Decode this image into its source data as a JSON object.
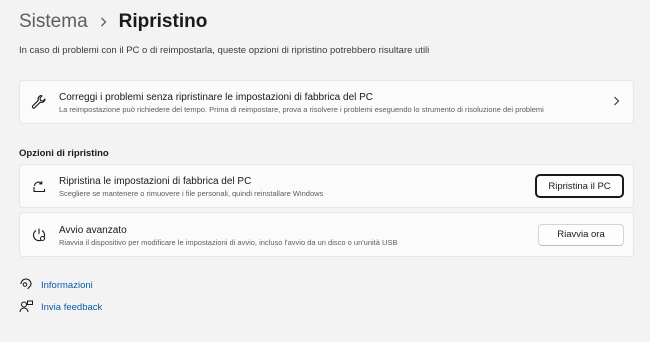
{
  "breadcrumb": {
    "parent": "Sistema",
    "current": "Ripristino"
  },
  "subtitle": "In caso di problemi con il PC o di reimpostarla, queste opzioni di ripristino potrebbero risultare utili",
  "fix_card": {
    "icon": "wrench-icon",
    "title": "Correggi i problemi senza ripristinare le impostazioni di fabbrica del PC",
    "description": "La reimpostazione può richiedere del tempo. Prima di reimpostare, prova a risolvere i problemi eseguendo lo strumento di risoluzione dei problemi"
  },
  "section_label": "Opzioni di ripristino",
  "reset_card": {
    "icon": "reset-pc-icon",
    "title": "Ripristina le impostazioni di fabbrica del PC",
    "description": "Scegliere se mantenere o rimuovere i file personali, quindi reinstallare Windows",
    "button": "Ripristina il PC"
  },
  "advanced_card": {
    "icon": "advanced-startup-icon",
    "title": "Avvio avanzato",
    "description": "Riavvia il dispositivo per modificare le impostazioni di avvio, incluso l'avvio da un disco o un'unità USB",
    "button": "Riavvia ora"
  },
  "links": {
    "info": "Informazioni",
    "feedback": "Invia feedback"
  },
  "colors": {
    "background": "#f3f3f3",
    "card": "#fbfbfb",
    "link": "#0a5ba8"
  }
}
